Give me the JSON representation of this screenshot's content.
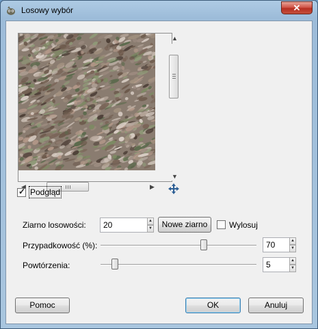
{
  "window": {
    "title": "Losowy wybór",
    "close_label": "✕"
  },
  "preview": {
    "checkbox_label": "Podgląd",
    "checked": true
  },
  "seed": {
    "label": "Ziarno losowości:",
    "value": "20",
    "new_seed_button": "Nowe ziarno",
    "randomize_label": "Wylosuj",
    "randomize_checked": false
  },
  "probability": {
    "label": "Przypadkowość (%):",
    "value": "70",
    "level_percent": 70
  },
  "repeat": {
    "label": "Powtórzenia:",
    "value": "5",
    "min": 1,
    "max": 100
  },
  "buttons": {
    "help": "Pomoc",
    "ok": "OK",
    "cancel": "Anuluj"
  }
}
